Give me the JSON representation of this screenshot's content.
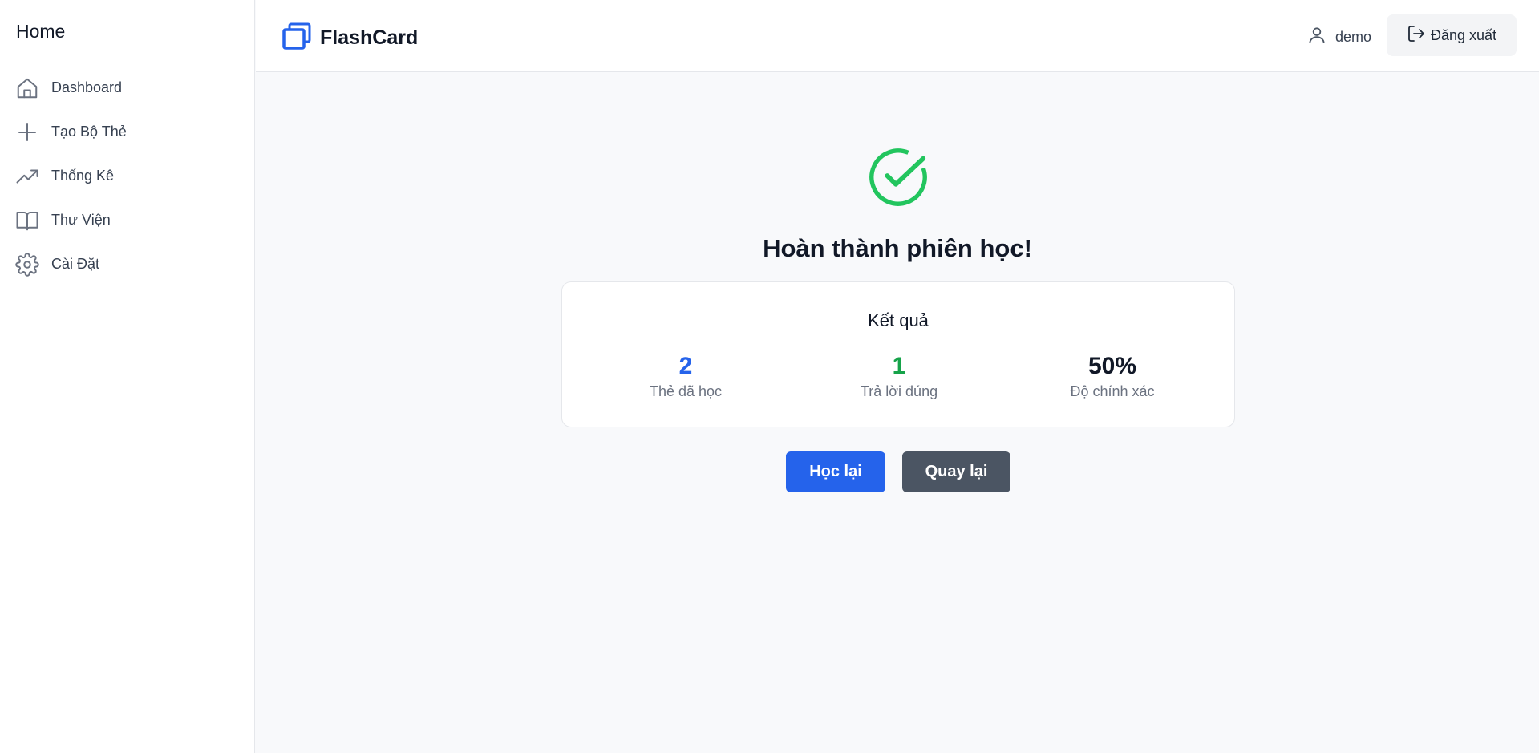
{
  "sidebar": {
    "title": "Home",
    "items": [
      {
        "label": "Dashboard",
        "icon": "home-icon"
      },
      {
        "label": "Tạo Bộ Thẻ",
        "icon": "plus-icon"
      },
      {
        "label": "Thống Kê",
        "icon": "trending-up-icon"
      },
      {
        "label": "Thư Viện",
        "icon": "book-icon"
      },
      {
        "label": "Cài Đặt",
        "icon": "gear-icon"
      }
    ]
  },
  "header": {
    "brand": "FlashCard",
    "brand_color": "#2563eb",
    "username": "demo",
    "logout_label": "Đăng xuất"
  },
  "main": {
    "title": "Hoàn thành phiên học!",
    "success_color": "#22c55e",
    "results": {
      "title": "Kết quả",
      "stats": [
        {
          "value": "2",
          "label": "Thẻ đã học",
          "color": "#2563eb"
        },
        {
          "value": "1",
          "label": "Trả lời đúng",
          "color": "#16a34a"
        },
        {
          "value": "50%",
          "label": "Độ chính xác",
          "color": "#111827"
        }
      ]
    },
    "buttons": {
      "relearn": "Học lại",
      "back": "Quay lại"
    }
  }
}
